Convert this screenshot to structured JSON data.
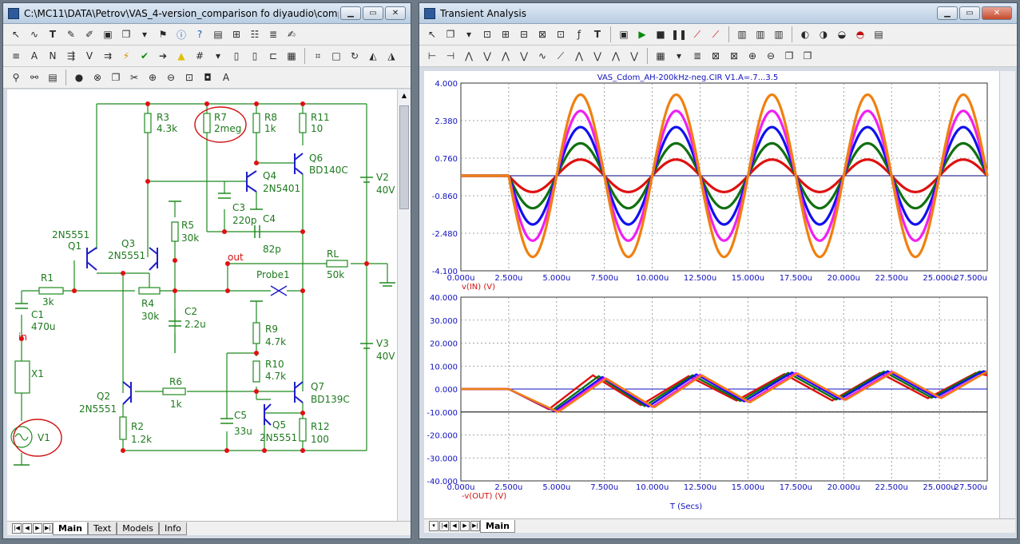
{
  "left_window": {
    "title": "C:\\MC11\\DATA\\Petrov\\VAS_4-version_comparison fo diyaudio\\compari...",
    "tabs": [
      "Main",
      "Text",
      "Models",
      "Info"
    ],
    "components": [
      {
        "ref": "R1",
        "value": "3k"
      },
      {
        "ref": "C1",
        "value": "470u"
      },
      {
        "ref": "X1",
        "value": ""
      },
      {
        "ref": "V1",
        "value": ""
      },
      {
        "ref": "Q1",
        "value": "2N5551"
      },
      {
        "ref": "Q3",
        "value": "2N5551"
      },
      {
        "ref": "R3",
        "value": "4.3k"
      },
      {
        "ref": "R4",
        "value": "30k"
      },
      {
        "ref": "R5",
        "value": "30k"
      },
      {
        "ref": "C2",
        "value": "2.2u"
      },
      {
        "ref": "R7",
        "value": "2meg"
      },
      {
        "ref": "R8",
        "value": "1k"
      },
      {
        "ref": "R11",
        "value": "10"
      },
      {
        "ref": "Q4",
        "value": "2N5401"
      },
      {
        "ref": "Q6",
        "value": "BD140C"
      },
      {
        "ref": "C3",
        "value": "220p"
      },
      {
        "ref": "C4",
        "value": "82p"
      },
      {
        "ref": "RL",
        "value": "50k"
      },
      {
        "ref": "V2",
        "value": "40V"
      },
      {
        "ref": "V3",
        "value": "40V"
      },
      {
        "ref": "R9",
        "value": "4.7k"
      },
      {
        "ref": "R10",
        "value": "4.7k"
      },
      {
        "ref": "Q7",
        "value": "BD139C"
      },
      {
        "ref": "Q2",
        "value": "2N5551"
      },
      {
        "ref": "R6",
        "value": "1k"
      },
      {
        "ref": "R2",
        "value": "1.2k"
      },
      {
        "ref": "C5",
        "value": "33u"
      },
      {
        "ref": "Q5",
        "value": "2N5551"
      },
      {
        "ref": "R12",
        "value": "100"
      }
    ],
    "net_labels": {
      "out": "out",
      "in": "in",
      "probe": "Probe1"
    }
  },
  "right_window": {
    "title": "Transient Analysis",
    "tabs": [
      "Main"
    ]
  },
  "chart_data": [
    {
      "type": "line",
      "title": "VAS_Cdom_AH-200kHz-neg.CIR V1.A=.7...3.5",
      "xlabel": "v(IN) (V)",
      "ylabel": "",
      "xlim": [
        0,
        27.5
      ],
      "ylim": [
        -4.1,
        4.0
      ],
      "x_ticks": [
        "0.000u",
        "2.500u",
        "5.000u",
        "7.500u",
        "10.000u",
        "12.500u",
        "15.000u",
        "17.500u",
        "20.000u",
        "22.500u",
        "25.000u",
        "27.500u"
      ],
      "y_ticks": [
        "4.000",
        "2.380",
        "0.760",
        "-0.860",
        "-2.480",
        "-4.100"
      ],
      "signal": {
        "start_us": 2.5,
        "period_us": 5.0,
        "offset": 0
      },
      "series": [
        {
          "amplitude": 0.7,
          "color": "#e01010"
        },
        {
          "amplitude": 1.4,
          "color": "#107010"
        },
        {
          "amplitude": 2.1,
          "color": "#1010f0"
        },
        {
          "amplitude": 2.8,
          "color": "#f020f0"
        },
        {
          "amplitude": 3.5,
          "color": "#f08010"
        }
      ]
    },
    {
      "type": "line",
      "title": "",
      "xlabel": "-v(OUT) (V)",
      "x_axis_title": "T (Secs)",
      "xlim": [
        0,
        27.5
      ],
      "ylim": [
        -40,
        40
      ],
      "x_ticks": [
        "0.000u",
        "2.500u",
        "5.000u",
        "7.500u",
        "10.000u",
        "12.500u",
        "15.000u",
        "17.500u",
        "20.000u",
        "22.500u",
        "25.000u",
        "27.500u"
      ],
      "y_ticks": [
        "40.000",
        "30.000",
        "20.000",
        "10.000",
        "0.000",
        "-10.000",
        "-20.000",
        "-30.000",
        "-40.000"
      ],
      "reference_lines": [
        0,
        -10
      ],
      "series": [
        {
          "color": "#e01010",
          "points": [
            [
              0,
              0
            ],
            [
              2.5,
              0
            ],
            [
              4.6,
              -8.8
            ],
            [
              6.9,
              6.0
            ],
            [
              9.4,
              -7.0
            ],
            [
              11.9,
              5.6
            ],
            [
              14.4,
              -5.0
            ],
            [
              16.9,
              6.5
            ],
            [
              19.4,
              -5.0
            ],
            [
              21.9,
              7.0
            ],
            [
              24.4,
              -4.0
            ],
            [
              26.9,
              7.0
            ],
            [
              27.5,
              6.0
            ]
          ]
        },
        {
          "color": "#107010",
          "points": [
            [
              0,
              0
            ],
            [
              2.5,
              0
            ],
            [
              4.8,
              -9.2
            ],
            [
              7.2,
              5.6
            ],
            [
              9.6,
              -7.4
            ],
            [
              12.1,
              6.0
            ],
            [
              14.6,
              -5.2
            ],
            [
              17.1,
              7.0
            ],
            [
              19.6,
              -4.6
            ],
            [
              22.1,
              7.6
            ],
            [
              24.6,
              -3.8
            ],
            [
              27.1,
              7.6
            ],
            [
              27.5,
              7.0
            ]
          ]
        },
        {
          "color": "#1010f0",
          "points": [
            [
              0,
              0
            ],
            [
              2.5,
              0
            ],
            [
              4.9,
              -9.6
            ],
            [
              7.4,
              5.2
            ],
            [
              9.8,
              -7.6
            ],
            [
              12.3,
              6.4
            ],
            [
              14.8,
              -5.4
            ],
            [
              17.3,
              7.2
            ],
            [
              19.8,
              -4.4
            ],
            [
              22.3,
              7.8
            ],
            [
              24.8,
              -3.6
            ],
            [
              27.3,
              7.8
            ],
            [
              27.5,
              7.4
            ]
          ]
        },
        {
          "color": "#f020f0",
          "points": [
            [
              0,
              0
            ],
            [
              2.5,
              0
            ],
            [
              5.0,
              -9.8
            ],
            [
              7.5,
              4.8
            ],
            [
              10.0,
              -7.8
            ],
            [
              12.5,
              6.2
            ],
            [
              15.0,
              -5.6
            ],
            [
              17.5,
              7.0
            ],
            [
              20.0,
              -4.6
            ],
            [
              22.5,
              7.6
            ],
            [
              25.0,
              -3.8
            ],
            [
              27.5,
              7.6
            ]
          ]
        },
        {
          "color": "#f08010",
          "points": [
            [
              0,
              0
            ],
            [
              2.5,
              0
            ],
            [
              5.1,
              -10.0
            ],
            [
              7.6,
              4.6
            ],
            [
              10.1,
              -8.0
            ],
            [
              12.6,
              6.0
            ],
            [
              15.1,
              -5.8
            ],
            [
              17.6,
              6.8
            ],
            [
              20.1,
              -4.8
            ],
            [
              22.6,
              7.4
            ],
            [
              25.1,
              -4.0
            ],
            [
              27.5,
              7.6
            ]
          ]
        }
      ]
    }
  ]
}
